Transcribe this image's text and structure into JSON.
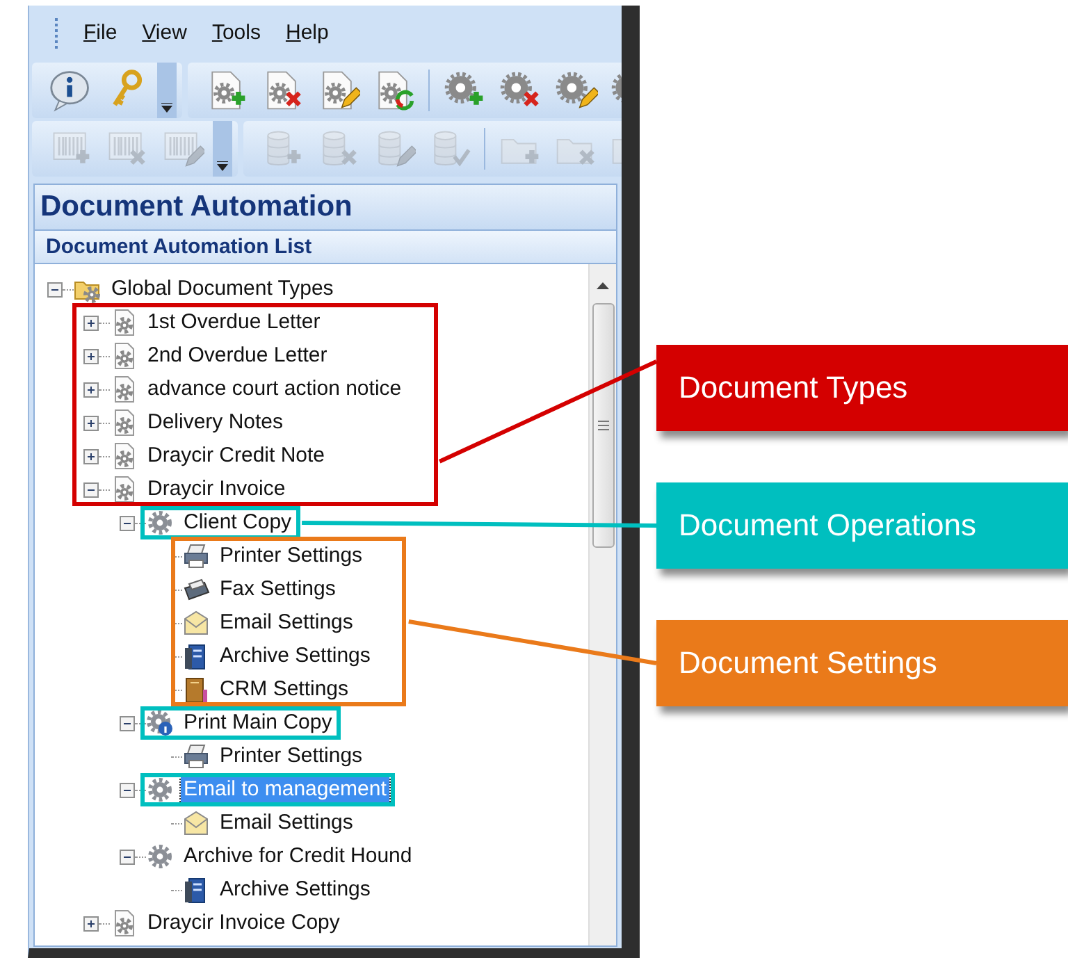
{
  "menu": [
    {
      "label": "File"
    },
    {
      "label": "View"
    },
    {
      "label": "Tools"
    },
    {
      "label": "Help"
    }
  ],
  "toolbars": [
    {
      "groups": [
        {
          "overflow": true,
          "buttons": [
            {
              "kind": "info",
              "disabled": false
            },
            {
              "kind": "key",
              "disabled": false
            }
          ]
        },
        {
          "overflow": false,
          "buttons": [
            {
              "kind": "document-add",
              "disabled": false
            },
            {
              "kind": "document-delete",
              "disabled": false
            },
            {
              "kind": "document-edit",
              "disabled": false
            },
            {
              "kind": "document-refresh",
              "disabled": false
            },
            {
              "kind": "separator"
            },
            {
              "kind": "gear-add",
              "disabled": false
            },
            {
              "kind": "gear-delete",
              "disabled": false
            },
            {
              "kind": "gear-edit",
              "disabled": false
            },
            {
              "kind": "gear",
              "disabled": false
            }
          ]
        }
      ]
    },
    {
      "groups": [
        {
          "overflow": true,
          "buttons": [
            {
              "kind": "barcode-add",
              "disabled": true
            },
            {
              "kind": "barcode-delete",
              "disabled": true
            },
            {
              "kind": "barcode-edit",
              "disabled": true
            }
          ]
        },
        {
          "overflow": false,
          "buttons": [
            {
              "kind": "database-add",
              "disabled": true
            },
            {
              "kind": "database-delete",
              "disabled": true
            },
            {
              "kind": "database-edit",
              "disabled": true
            },
            {
              "kind": "database-check",
              "disabled": true
            },
            {
              "kind": "separator"
            },
            {
              "kind": "folder-add",
              "disabled": true
            },
            {
              "kind": "folder-delete",
              "disabled": true
            },
            {
              "kind": "folder",
              "disabled": true
            }
          ]
        }
      ]
    }
  ],
  "panel_title": "Document Automation",
  "list_title": "Document Automation List",
  "tree": {
    "label": "Global Document Types",
    "kind": "folder",
    "expanded": true,
    "selected": false,
    "children": [
      {
        "label": "1st Overdue Letter",
        "kind": "document",
        "expanded": false,
        "selected": false,
        "outlined": true
      },
      {
        "label": "2nd Overdue Letter",
        "kind": "document",
        "expanded": false,
        "selected": false,
        "outlined": true
      },
      {
        "label": "advance court action notice",
        "kind": "document",
        "expanded": false,
        "selected": false,
        "outlined": true
      },
      {
        "label": "Delivery Notes",
        "kind": "document",
        "expanded": false,
        "selected": false,
        "outlined": true
      },
      {
        "label": "Draycir Credit Note",
        "kind": "document",
        "expanded": false,
        "selected": false,
        "outlined": true
      },
      {
        "label": "Draycir Invoice",
        "kind": "document",
        "expanded": true,
        "selected": false,
        "outlined": true,
        "children": [
          {
            "label": "Client Copy",
            "kind": "operation",
            "expanded": true,
            "selected": false,
            "outlined": true,
            "children": [
              {
                "label": "Printer Settings",
                "kind": "printer",
                "selected": false,
                "outlined": true
              },
              {
                "label": "Fax Settings",
                "kind": "fax",
                "selected": false,
                "outlined": true
              },
              {
                "label": "Email Settings",
                "kind": "email",
                "selected": false,
                "outlined": true
              },
              {
                "label": "Archive Settings",
                "kind": "archive",
                "selected": false,
                "outlined": true
              },
              {
                "label": "CRM Settings",
                "kind": "crm",
                "selected": false,
                "outlined": true
              }
            ]
          },
          {
            "label": "Print Main Copy",
            "kind": "operation-info",
            "expanded": true,
            "selected": false,
            "outlined": true,
            "children": [
              {
                "label": "Printer Settings",
                "kind": "printer",
                "selected": false,
                "outlined": false
              }
            ]
          },
          {
            "label": "Email to management",
            "kind": "operation",
            "expanded": true,
            "selected": true,
            "outlined": true,
            "children": [
              {
                "label": "Email Settings",
                "kind": "email",
                "selected": false,
                "outlined": false
              }
            ]
          },
          {
            "label": "Archive for Credit Hound",
            "kind": "operation",
            "expanded": true,
            "selected": false,
            "outlined": false,
            "children": [
              {
                "label": "Archive Settings",
                "kind": "archive",
                "selected": false,
                "outlined": false
              }
            ]
          }
        ]
      },
      {
        "label": "Draycir Invoice Copy",
        "kind": "document",
        "expanded": false,
        "selected": false,
        "outlined": false
      }
    ]
  },
  "annotations": [
    {
      "kind": "types",
      "label": "Document Types",
      "color": "#d40000"
    },
    {
      "kind": "operations",
      "label": "Document Operations",
      "color": "#00bfbf"
    },
    {
      "kind": "settings",
      "label": "Document Settings",
      "color": "#ea7a1a"
    }
  ]
}
